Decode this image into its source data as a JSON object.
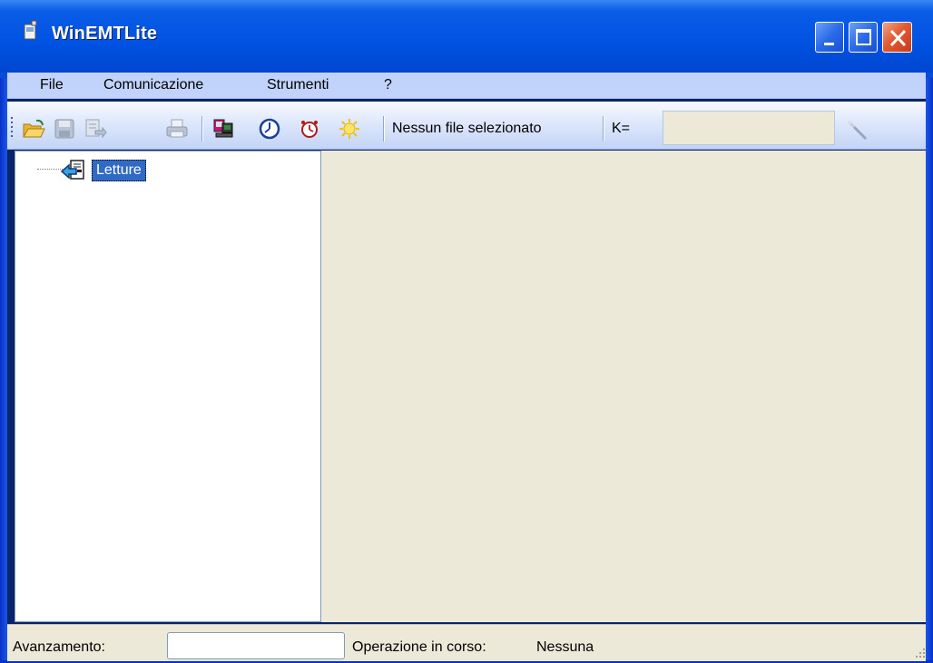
{
  "window": {
    "title": "WinEMTLite",
    "controls": {
      "minimize": "minimize",
      "maximize": "maximize",
      "close": "close"
    }
  },
  "menubar": {
    "items": [
      "File",
      "Comunicazione",
      "Strumenti",
      "?"
    ]
  },
  "toolbar": {
    "icons": [
      "open-folder-icon",
      "save-icon",
      "export-icon",
      "print-icon",
      "computer-icon",
      "clock-icon",
      "alarm-clock-icon",
      "sun-icon",
      "wand-icon"
    ],
    "file_status": "Nessun file selezionato",
    "k_label": "K=",
    "k_value": ""
  },
  "tree": {
    "nodes": [
      {
        "label": "Letture",
        "selected": true
      }
    ]
  },
  "statusbar": {
    "progress_label": "Avanzamento:",
    "progress_value": 0,
    "operation_label": "Operazione in corso:",
    "operation_value": "Nessuna"
  },
  "colors": {
    "titlebar": "#0052e2",
    "menubar": "#c1d3fb",
    "selection": "#316ac5",
    "face": "#ece9d8",
    "close_button": "#e05b33"
  }
}
